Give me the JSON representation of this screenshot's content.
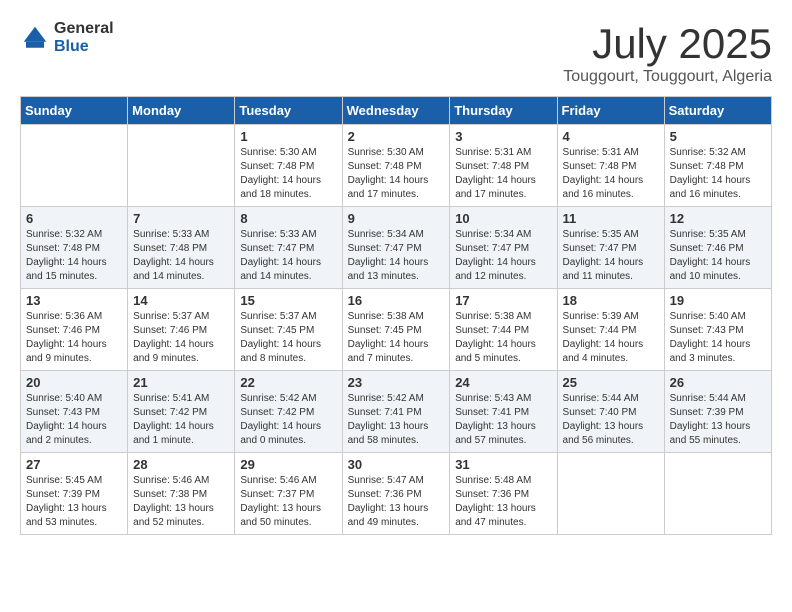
{
  "header": {
    "logo_general": "General",
    "logo_blue": "Blue",
    "month": "July 2025",
    "location": "Touggourt, Touggourt, Algeria"
  },
  "weekdays": [
    "Sunday",
    "Monday",
    "Tuesday",
    "Wednesday",
    "Thursday",
    "Friday",
    "Saturday"
  ],
  "weeks": [
    [
      {
        "day": "",
        "sunrise": "",
        "sunset": "",
        "daylight": ""
      },
      {
        "day": "",
        "sunrise": "",
        "sunset": "",
        "daylight": ""
      },
      {
        "day": "1",
        "sunrise": "Sunrise: 5:30 AM",
        "sunset": "Sunset: 7:48 PM",
        "daylight": "Daylight: 14 hours and 18 minutes."
      },
      {
        "day": "2",
        "sunrise": "Sunrise: 5:30 AM",
        "sunset": "Sunset: 7:48 PM",
        "daylight": "Daylight: 14 hours and 17 minutes."
      },
      {
        "day": "3",
        "sunrise": "Sunrise: 5:31 AM",
        "sunset": "Sunset: 7:48 PM",
        "daylight": "Daylight: 14 hours and 17 minutes."
      },
      {
        "day": "4",
        "sunrise": "Sunrise: 5:31 AM",
        "sunset": "Sunset: 7:48 PM",
        "daylight": "Daylight: 14 hours and 16 minutes."
      },
      {
        "day": "5",
        "sunrise": "Sunrise: 5:32 AM",
        "sunset": "Sunset: 7:48 PM",
        "daylight": "Daylight: 14 hours and 16 minutes."
      }
    ],
    [
      {
        "day": "6",
        "sunrise": "Sunrise: 5:32 AM",
        "sunset": "Sunset: 7:48 PM",
        "daylight": "Daylight: 14 hours and 15 minutes."
      },
      {
        "day": "7",
        "sunrise": "Sunrise: 5:33 AM",
        "sunset": "Sunset: 7:48 PM",
        "daylight": "Daylight: 14 hours and 14 minutes."
      },
      {
        "day": "8",
        "sunrise": "Sunrise: 5:33 AM",
        "sunset": "Sunset: 7:47 PM",
        "daylight": "Daylight: 14 hours and 14 minutes."
      },
      {
        "day": "9",
        "sunrise": "Sunrise: 5:34 AM",
        "sunset": "Sunset: 7:47 PM",
        "daylight": "Daylight: 14 hours and 13 minutes."
      },
      {
        "day": "10",
        "sunrise": "Sunrise: 5:34 AM",
        "sunset": "Sunset: 7:47 PM",
        "daylight": "Daylight: 14 hours and 12 minutes."
      },
      {
        "day": "11",
        "sunrise": "Sunrise: 5:35 AM",
        "sunset": "Sunset: 7:47 PM",
        "daylight": "Daylight: 14 hours and 11 minutes."
      },
      {
        "day": "12",
        "sunrise": "Sunrise: 5:35 AM",
        "sunset": "Sunset: 7:46 PM",
        "daylight": "Daylight: 14 hours and 10 minutes."
      }
    ],
    [
      {
        "day": "13",
        "sunrise": "Sunrise: 5:36 AM",
        "sunset": "Sunset: 7:46 PM",
        "daylight": "Daylight: 14 hours and 9 minutes."
      },
      {
        "day": "14",
        "sunrise": "Sunrise: 5:37 AM",
        "sunset": "Sunset: 7:46 PM",
        "daylight": "Daylight: 14 hours and 9 minutes."
      },
      {
        "day": "15",
        "sunrise": "Sunrise: 5:37 AM",
        "sunset": "Sunset: 7:45 PM",
        "daylight": "Daylight: 14 hours and 8 minutes."
      },
      {
        "day": "16",
        "sunrise": "Sunrise: 5:38 AM",
        "sunset": "Sunset: 7:45 PM",
        "daylight": "Daylight: 14 hours and 7 minutes."
      },
      {
        "day": "17",
        "sunrise": "Sunrise: 5:38 AM",
        "sunset": "Sunset: 7:44 PM",
        "daylight": "Daylight: 14 hours and 5 minutes."
      },
      {
        "day": "18",
        "sunrise": "Sunrise: 5:39 AM",
        "sunset": "Sunset: 7:44 PM",
        "daylight": "Daylight: 14 hours and 4 minutes."
      },
      {
        "day": "19",
        "sunrise": "Sunrise: 5:40 AM",
        "sunset": "Sunset: 7:43 PM",
        "daylight": "Daylight: 14 hours and 3 minutes."
      }
    ],
    [
      {
        "day": "20",
        "sunrise": "Sunrise: 5:40 AM",
        "sunset": "Sunset: 7:43 PM",
        "daylight": "Daylight: 14 hours and 2 minutes."
      },
      {
        "day": "21",
        "sunrise": "Sunrise: 5:41 AM",
        "sunset": "Sunset: 7:42 PM",
        "daylight": "Daylight: 14 hours and 1 minute."
      },
      {
        "day": "22",
        "sunrise": "Sunrise: 5:42 AM",
        "sunset": "Sunset: 7:42 PM",
        "daylight": "Daylight: 14 hours and 0 minutes."
      },
      {
        "day": "23",
        "sunrise": "Sunrise: 5:42 AM",
        "sunset": "Sunset: 7:41 PM",
        "daylight": "Daylight: 13 hours and 58 minutes."
      },
      {
        "day": "24",
        "sunrise": "Sunrise: 5:43 AM",
        "sunset": "Sunset: 7:41 PM",
        "daylight": "Daylight: 13 hours and 57 minutes."
      },
      {
        "day": "25",
        "sunrise": "Sunrise: 5:44 AM",
        "sunset": "Sunset: 7:40 PM",
        "daylight": "Daylight: 13 hours and 56 minutes."
      },
      {
        "day": "26",
        "sunrise": "Sunrise: 5:44 AM",
        "sunset": "Sunset: 7:39 PM",
        "daylight": "Daylight: 13 hours and 55 minutes."
      }
    ],
    [
      {
        "day": "27",
        "sunrise": "Sunrise: 5:45 AM",
        "sunset": "Sunset: 7:39 PM",
        "daylight": "Daylight: 13 hours and 53 minutes."
      },
      {
        "day": "28",
        "sunrise": "Sunrise: 5:46 AM",
        "sunset": "Sunset: 7:38 PM",
        "daylight": "Daylight: 13 hours and 52 minutes."
      },
      {
        "day": "29",
        "sunrise": "Sunrise: 5:46 AM",
        "sunset": "Sunset: 7:37 PM",
        "daylight": "Daylight: 13 hours and 50 minutes."
      },
      {
        "day": "30",
        "sunrise": "Sunrise: 5:47 AM",
        "sunset": "Sunset: 7:36 PM",
        "daylight": "Daylight: 13 hours and 49 minutes."
      },
      {
        "day": "31",
        "sunrise": "Sunrise: 5:48 AM",
        "sunset": "Sunset: 7:36 PM",
        "daylight": "Daylight: 13 hours and 47 minutes."
      },
      {
        "day": "",
        "sunrise": "",
        "sunset": "",
        "daylight": ""
      },
      {
        "day": "",
        "sunrise": "",
        "sunset": "",
        "daylight": ""
      }
    ]
  ]
}
